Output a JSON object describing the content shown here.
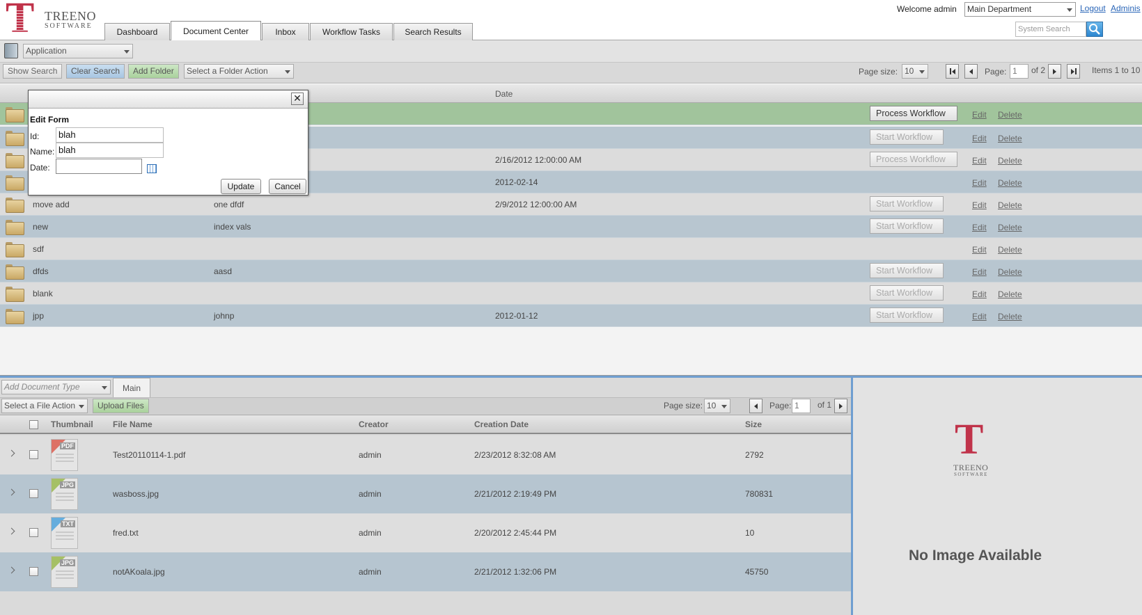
{
  "header": {
    "logo": {
      "letter": "T",
      "name": "TREENO",
      "sub": "SOFTWARE"
    },
    "tabs": [
      "Dashboard",
      "Document Center",
      "Inbox",
      "Workflow Tasks",
      "Search Results"
    ],
    "welcome": "Welcome  admin",
    "department": "Main Department",
    "logout": "Logout",
    "admin_link": "Adminis",
    "system_search_placeholder": "System Search"
  },
  "app_row": {
    "selected": "Application"
  },
  "action_row": {
    "show_search": "Show Search",
    "clear_search": "Clear Search",
    "add_folder": "Add Folder",
    "folder_action": "Select a Folder Action",
    "page_size_label": "Page size:",
    "page_size": "10",
    "page_label": "Page:",
    "page": "1",
    "of_pages": "of 2",
    "items": "Items 1 to 10"
  },
  "grid": {
    "date_header": "Date",
    "rows": [
      {
        "name": "",
        "index": "",
        "date": "",
        "workflow": "Process Workflow",
        "wf_enabled": true,
        "edit": "Edit",
        "delete": "Delete"
      },
      {
        "name": "",
        "index": "",
        "date": "",
        "workflow": "Start Workflow",
        "wf_enabled": false,
        "edit": "Edit",
        "delete": "Delete"
      },
      {
        "name": "",
        "index": "",
        "date": "2/16/2012 12:00:00 AM",
        "workflow": "Process Workflow",
        "wf_enabled": false,
        "edit": "Edit",
        "delete": "Delete"
      },
      {
        "name": "",
        "index": "",
        "date": "2012-02-14",
        "workflow": "",
        "wf_enabled": false,
        "edit": "Edit",
        "delete": "Delete"
      },
      {
        "name": "move add",
        "index": "one dfdf",
        "date": "2/9/2012 12:00:00 AM",
        "workflow": "Start Workflow",
        "wf_enabled": false,
        "edit": "Edit",
        "delete": "Delete"
      },
      {
        "name": "new",
        "index": "index vals",
        "date": "",
        "workflow": "Start Workflow",
        "wf_enabled": false,
        "edit": "Edit",
        "delete": "Delete"
      },
      {
        "name": "sdf",
        "index": "",
        "date": "",
        "workflow": "",
        "wf_enabled": false,
        "edit": "Edit",
        "delete": "Delete"
      },
      {
        "name": "dfds",
        "index": "aasd",
        "date": "",
        "workflow": "Start Workflow",
        "wf_enabled": false,
        "edit": "Edit",
        "delete": "Delete"
      },
      {
        "name": "blank",
        "index": "",
        "date": "",
        "workflow": "Start Workflow",
        "wf_enabled": false,
        "edit": "Edit",
        "delete": "Delete"
      },
      {
        "name": "jpp",
        "index": "johnp",
        "date": "2012-01-12",
        "workflow": "Start Workflow",
        "wf_enabled": false,
        "edit": "Edit",
        "delete": "Delete"
      }
    ]
  },
  "dialog": {
    "close": "✕",
    "title": "Edit Form",
    "id_label": "Id:",
    "id_value": "blah",
    "name_label": "Name:",
    "name_value": "blah",
    "date_label": "Date:",
    "date_value": "",
    "update": "Update",
    "cancel": "Cancel"
  },
  "files": {
    "add_doc_type_placeholder": "Add Document Type",
    "main_tab": "Main",
    "file_action": "Select a File Action",
    "upload": "Upload Files",
    "page_size_label": "Page size:",
    "page_size": "10",
    "page_label": "Page:",
    "page": "1",
    "of_pages": "of 1",
    "headers": {
      "thumbnail": "Thumbnail",
      "file_name": "File Name",
      "creator": "Creator",
      "creation_date": "Creation Date",
      "size": "Size"
    },
    "rows": [
      {
        "ext": "PDF",
        "band": "#d94a3a",
        "name": "Test20110114-1.pdf",
        "creator": "admin",
        "date": "2/23/2012 8:32:08 AM",
        "size": "2792"
      },
      {
        "ext": "JPG",
        "band": "#8fb33a",
        "name": "wasboss.jpg",
        "creator": "admin",
        "date": "2/21/2012 2:19:49 PM",
        "size": "780831"
      },
      {
        "ext": "TXT",
        "band": "#3a9ad9",
        "name": "fred.txt",
        "creator": "admin",
        "date": "2/20/2012 2:45:44 PM",
        "size": "10"
      },
      {
        "ext": "JPG",
        "band": "#8fb33a",
        "name": "notAKoala.jpg",
        "creator": "admin",
        "date": "2/21/2012 1:32:06 PM",
        "size": "45750"
      }
    ]
  },
  "preview": {
    "logo_letter": "T",
    "logo_name": "TREENO",
    "logo_sub": "SOFTWARE",
    "text": "No Image Available"
  }
}
